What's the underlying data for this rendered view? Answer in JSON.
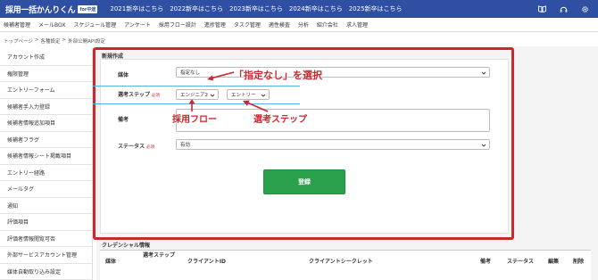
{
  "header": {
    "logo_main": "採用一括かんりくん",
    "logo_sub": "for中途",
    "year_links": [
      "2021新卒はこちら",
      "2022新卒はこちら",
      "2023新卒はこちら",
      "2024新卒はこちら",
      "2025新卒はこちら"
    ],
    "icons": [
      "book-icon",
      "headset-icon",
      "gear-icon"
    ]
  },
  "nav": {
    "items": [
      "候補者管理",
      "メールBOX",
      "スケジュール管理",
      "アンケート",
      "採用フロー設計",
      "進捗管理",
      "タスク管理",
      "適性検査",
      "分析",
      "紹介会社",
      "求人管理"
    ]
  },
  "breadcrumb": [
    "トップページ",
    ">",
    "各種設定",
    ">",
    "外部公開API設定"
  ],
  "sidebar": {
    "items": [
      "アカウント作成",
      "権限管理",
      "エントリーフォーム",
      "候補者手入力登録",
      "候補者情報追加項目",
      "候補者フラグ",
      "候補者情報シート掲載項目",
      "エントリー経路",
      "メールタグ",
      "通知",
      "評価項目",
      "評価者情報閲覧可否",
      "外部サービスアカウント管理",
      "媒体自動取り込み設定"
    ]
  },
  "form": {
    "title": "新規作成",
    "medium_label": "媒体",
    "medium_value": "指定なし",
    "step_label": "選考ステップ",
    "required": "必須",
    "flow_value": "エンジニア2",
    "step_value": "エントリー",
    "remarks_label": "備考",
    "status_label": "ステータス",
    "status_value": "有効",
    "submit_label": "登録"
  },
  "annotations": {
    "select_none": "「指定なし」を選択",
    "flow": "採用フロー",
    "step": "選考ステップ",
    "color": "#c8282e"
  },
  "credentials": {
    "title": "クレデンシャル情報",
    "columns": [
      "媒体",
      "選考ステップ",
      "クライアントID",
      "クライアントシークレット",
      "備考",
      "ステータス",
      "編集",
      "削除"
    ]
  },
  "colors": {
    "header_bg": "#2f4fa3",
    "accent_red": "#c8282e",
    "submit_green": "#2aa04a"
  }
}
